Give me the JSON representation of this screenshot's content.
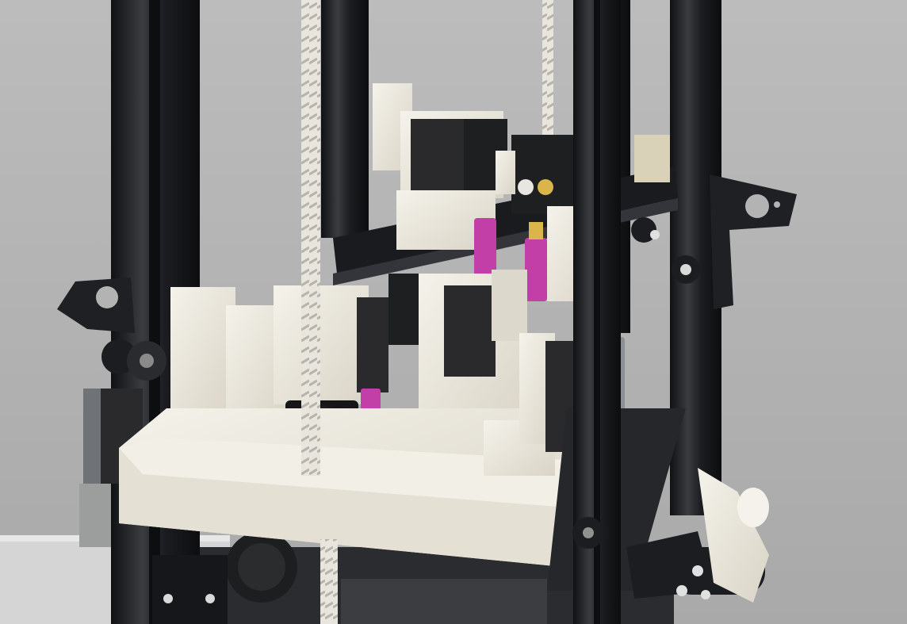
{
  "colors": {
    "background": "#b3b3b3",
    "frame": "#1c1d20",
    "frame_highlight": "#3a3c40",
    "printed_part": "#ece9df",
    "printed_shadow": "#cfcabd",
    "motor": "#2a2a2d",
    "motor_cap": "#8c8f93",
    "heater_block": "#c23fa8",
    "leadscrew": "#e6e3dc",
    "brass": "#d9b54a",
    "bed": "#2a2b2e",
    "plate_gray": "#cfd0cf"
  },
  "icons": [
    "stepper-motor-icon",
    "cooling-fan-icon",
    "leadscrew-icon",
    "wheel-icon"
  ]
}
